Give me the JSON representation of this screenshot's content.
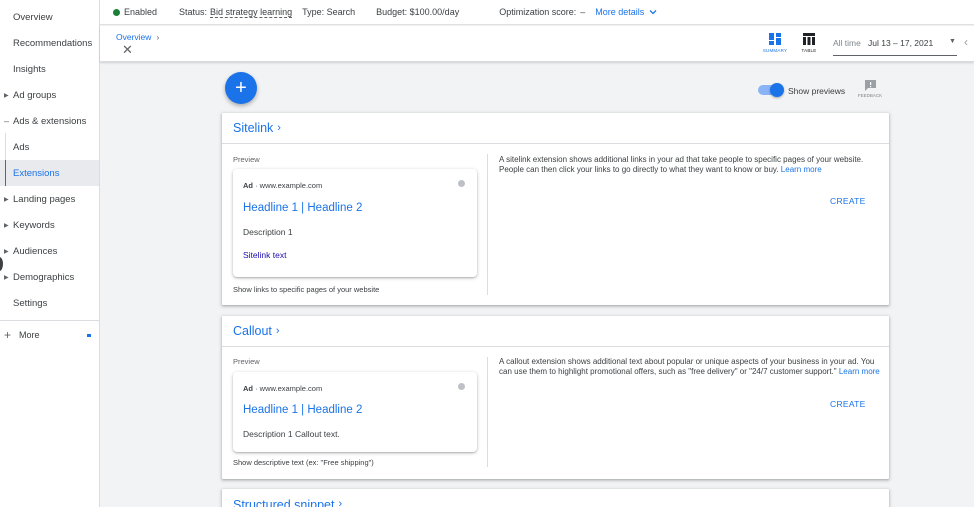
{
  "sidebar": {
    "items": [
      {
        "label": "Overview"
      },
      {
        "label": "Recommendations"
      },
      {
        "label": "Insights"
      },
      {
        "label": "Ad groups"
      },
      {
        "label": "Ads & extensions"
      },
      {
        "label": "Ads"
      },
      {
        "label": "Extensions"
      },
      {
        "label": "Landing pages"
      },
      {
        "label": "Keywords"
      },
      {
        "label": "Audiences"
      },
      {
        "label": "Demographics"
      },
      {
        "label": "Settings"
      }
    ],
    "more_label": "More"
  },
  "statusbar": {
    "enabled": "Enabled",
    "status_prefix": "Status:",
    "status_value": "Bid strategy learning",
    "type": "Type: Search",
    "budget": "Budget: $100.00/day",
    "optimization": "Optimization score:",
    "optimization_value": "–",
    "more_details": "More details"
  },
  "header": {
    "breadcrumb": "Overview",
    "summary_label": "SUMMARY",
    "table_label": "TABLE",
    "date_label": "All time",
    "date_value": "Jul 13 – 17, 2021"
  },
  "controls": {
    "show_previews": "Show previews",
    "feedback": "FEEDBACK"
  },
  "cards": [
    {
      "title": "Sitelink",
      "preview_label": "Preview",
      "ad_label": "Ad",
      "url": "· www.example.com",
      "headline": "Headline 1 | Headline 2",
      "description": "Description 1",
      "sitelink": "Sitelink text",
      "caption": "Show links to specific pages of your website",
      "info": "A sitelink extension shows additional links in your ad that take people to specific pages of your website. People can then click your links to go directly to what they want to know or buy.",
      "learn_more": "Learn more",
      "create": "CREATE"
    },
    {
      "title": "Callout",
      "preview_label": "Preview",
      "ad_label": "Ad",
      "url": "· www.example.com",
      "headline": "Headline 1 | Headline 2",
      "description": "Description 1 Callout text.",
      "caption": "Show descriptive text (ex: \"Free shipping\")",
      "info": "A callout extension shows additional text about popular or unique aspects of your business in your ad. You can use them to highlight promotional offers, such as \"free delivery\" or \"24/7 customer support.\"",
      "learn_more": "Learn more",
      "create": "CREATE"
    },
    {
      "title": "Structured snippet"
    }
  ]
}
